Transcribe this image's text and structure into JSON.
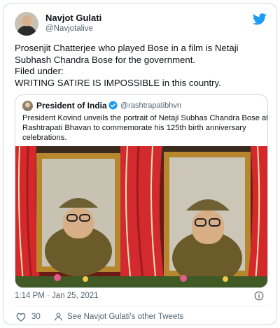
{
  "author": {
    "name": "Navjot Gulati",
    "handle": "@Navjotalive"
  },
  "tweet": {
    "lines": [
      "Prosenjit Chatterjee who played Bose in a film is Netaji",
      "Subhash Chandra Bose for the government.",
      "Filed under:",
      "WRITING SATIRE IS IMPOSSIBLE in this country."
    ]
  },
  "quoted": {
    "name": "President of India",
    "handle": "@rashtrapatibhvn",
    "lines": [
      "President Kovind unveils the portrait of Netaji Subhas Chandra Bose at",
      "Rashtrapati Bhavan to commemorate his 125th birth anniversary",
      "celebrations."
    ]
  },
  "meta": {
    "timestamp": "1:14 PM · Jan 25, 2021",
    "like_count": "30",
    "other_tweets_label": "See Navjot Gulati's other Tweets"
  },
  "icons": {
    "brand": "twitter-bird-icon",
    "verified": "verified-badge-icon",
    "info": "info-icon",
    "like": "heart-icon",
    "profile": "person-icon"
  },
  "colors": {
    "twitter_blue": "#1d9bf0",
    "text_primary": "#0f1419",
    "text_secondary": "#536471",
    "border": "#cfd9de"
  }
}
